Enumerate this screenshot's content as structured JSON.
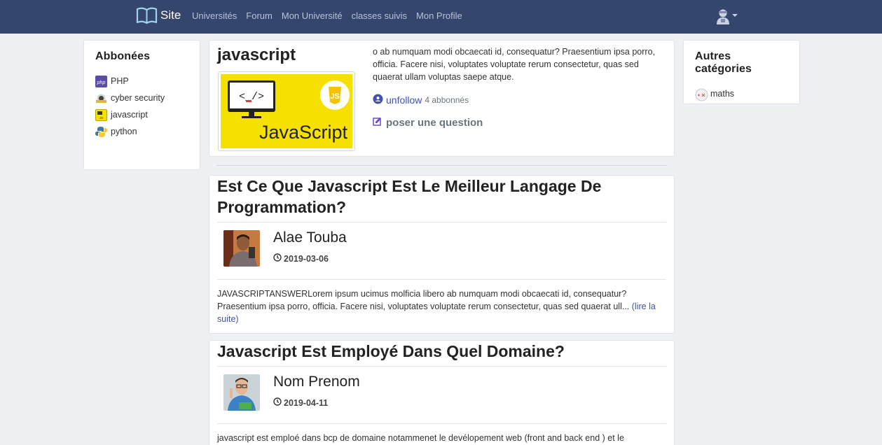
{
  "navbar": {
    "brand": "Site",
    "links": [
      "Universités",
      "Forum",
      "Mon Université",
      "classes suivis",
      "Mon Profile"
    ],
    "user_icon": "user-avatar-icon"
  },
  "left_sidebar": {
    "title": "Abbonées",
    "items": [
      {
        "label": "PHP",
        "icon": "php-icon"
      },
      {
        "label": "cyber security",
        "icon": "cyber-security-icon"
      },
      {
        "label": "javascript",
        "icon": "javascript-icon"
      },
      {
        "label": "python",
        "icon": "python-icon"
      }
    ]
  },
  "category": {
    "title": "javascript",
    "image_text": "JavaScript",
    "image_badge": "JS",
    "image_code": "<_/>",
    "description": "o ab numquam modi obcaecati id, consequatur? Praesentium ipsa porro, officia. Facere nisi, voluptates voluptate rerum consectetur, quas sed quaerat ullam voluptas saepe atque.",
    "unfollow_label": "unfollow",
    "subscribers": "4 abbonnés",
    "ask_label": "poser une question"
  },
  "posts": [
    {
      "title": "Est Ce Que Javascript Est Le Meilleur Langage De Programmation?",
      "author": "Alae Touba",
      "date": "2019-03-06",
      "body": "JAVASCRIPTANSWERLorem ipsum ucimus molficia libero ab numquam modi obcaecati id, consequatur? Praesentium ipsa porro, officia. Facere nisi, voluptates voluptate rerum consectetur, quas sed quaerat ull...",
      "read_more": "(lire la suite)"
    },
    {
      "title": "Javascript Est Employé Dans Quel Domaine?",
      "author": "Nom Prenom",
      "date": "2019-04-11",
      "body": "javascript est emploé dans bcp de domaine notammenet le devélopement web (front and back end ) et le",
      "read_more": ""
    }
  ],
  "right_sidebar": {
    "title": "Autres catégories",
    "items": [
      {
        "label": "maths",
        "icon": "maths-icon"
      }
    ]
  },
  "colors": {
    "navbar": "#34466e",
    "link": "#3f51b5",
    "background": "#eef0f4",
    "js_yellow": "#f6e000"
  }
}
